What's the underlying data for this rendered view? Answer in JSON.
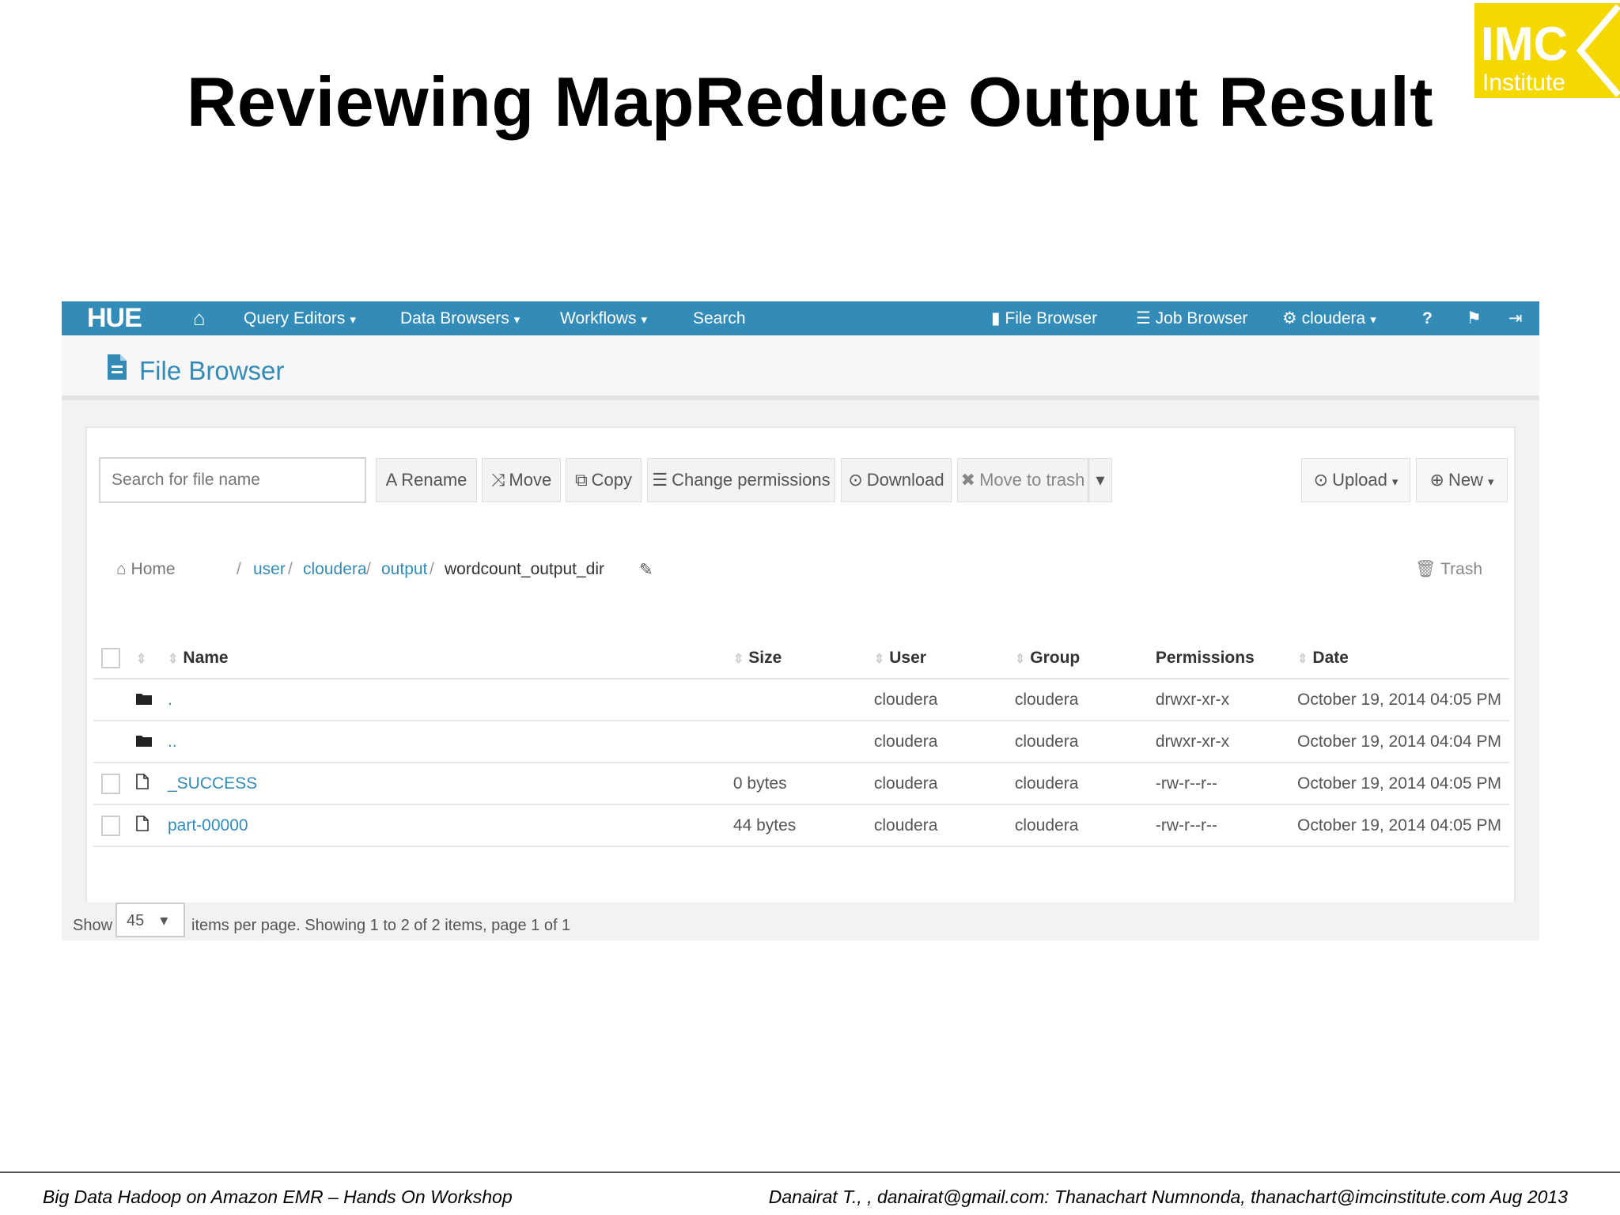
{
  "slide": {
    "title": "Reviewing MapReduce Output Result",
    "logo": {
      "line1": "IMC",
      "line2": "Institute"
    },
    "footer_left": "Big Data Hadoop on Amazon EMR – Hands On Workshop",
    "footer_right": "Danairat T., , danairat@gmail.com:  Thanachart Numnonda,  thanachart@imcinstitute.com   Aug 2013"
  },
  "navbar": {
    "brand": "HUE",
    "home": "⌂",
    "query_editors": "Query Editors",
    "data_browsers": "Data Browsers",
    "workflows": "Workflows",
    "search": "Search",
    "file_browser": "File Browser",
    "job_browser": "Job Browser",
    "user": "cloudera",
    "help": "?",
    "flag": "⚑",
    "logout": "⇥"
  },
  "file_browser": {
    "title": "File Browser",
    "search_placeholder": "Search for file name",
    "actions": {
      "rename": "Rename",
      "move": "Move",
      "copy": "Copy",
      "change_permissions": "Change permissions",
      "download": "Download",
      "move_to_trash": "Move to trash",
      "upload": "Upload",
      "new": "New"
    },
    "breadcrumb": {
      "home": "Home",
      "user": "user",
      "cloudera": "cloudera",
      "output": "output",
      "current": "wordcount_output_dir",
      "sep": "/",
      "trash": "Trash"
    },
    "columns": {
      "name": "Name",
      "size": "Size",
      "user": "User",
      "group": "Group",
      "permissions": "Permissions",
      "date": "Date"
    },
    "rows": [
      {
        "type": "folder",
        "name": ".",
        "size": "",
        "user": "cloudera",
        "group": "cloudera",
        "permissions": "drwxr-xr-x",
        "date": "October 19, 2014 04:05 PM"
      },
      {
        "type": "folder",
        "name": "..",
        "size": "",
        "user": "cloudera",
        "group": "cloudera",
        "permissions": "drwxr-xr-x",
        "date": "October 19, 2014 04:04 PM"
      },
      {
        "type": "file",
        "name": "_SUCCESS",
        "size": "0 bytes",
        "user": "cloudera",
        "group": "cloudera",
        "permissions": "-rw-r--r--",
        "date": "October 19, 2014 04:05 PM"
      },
      {
        "type": "file",
        "name": "part-00000",
        "size": "44 bytes",
        "user": "cloudera",
        "group": "cloudera",
        "permissions": "-rw-r--r--",
        "date": "October 19, 2014 04:05 PM"
      }
    ],
    "pagination": {
      "show": "Show",
      "per_page_value": "45",
      "summary": "items per page. Showing 1 to 2 of 2 items, page 1 of 1"
    }
  },
  "colors": {
    "accent": "#338bb8",
    "logo_yellow": "#f5d800"
  }
}
